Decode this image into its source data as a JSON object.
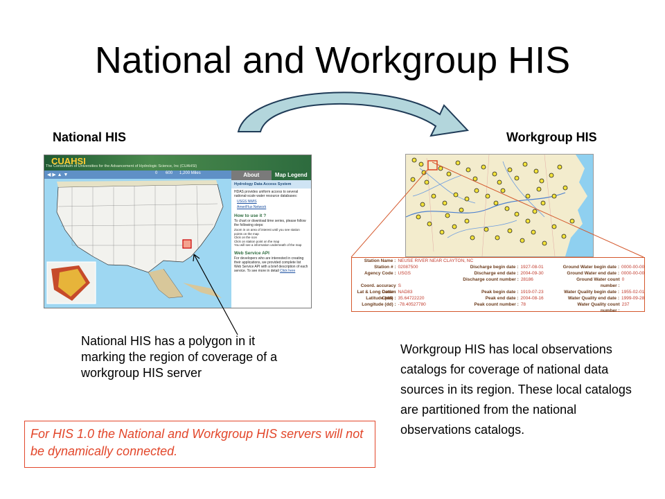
{
  "slide": {
    "title": "National and Workgroup HIS",
    "left_label": "National HIS",
    "right_label": "Workgroup HIS",
    "left_caption": "National HIS has a polygon in it marking the region of coverage of a workgroup HIS server",
    "right_caption": "Workgroup HIS has local observations catalogs for coverage of national data sources in its region.  These local catalogs are partitioned from the national observations catalogs.",
    "note": "For HIS 1.0 the National and Workgroup HIS servers will not be dynamically connected."
  },
  "national_screenshot": {
    "banner_text": "The Consortium of Universities for the Advancement of Hydrologic Science, Inc (CUAHSI)",
    "logo_text": "CUAHSI",
    "tab_about": "About",
    "tab_legend": "Map Legend",
    "scale_labels": [
      "0",
      "600",
      "1,200 Miles"
    ],
    "panel_heading": "Hydrology Data Access System",
    "panel_intro": "HDAS provides uniform access to several national-scale water resource databases:",
    "links": [
      "USGS NWIS",
      "AmeriFlux Network"
    ],
    "howto_heading": "How to use it ?",
    "howto_intro": "To chart or download time series, please follow the following steps:",
    "steps": [
      "Zoom in on area of interest until you see station points on the map",
      "Click on the icon",
      "Click on station point on the map",
      "You will see a information underneath of the map"
    ],
    "api_heading": "Web Service API",
    "api_text": "For developers who are interested in creating their applications, we provided complete list Web Service API with a brief description of each service. To see more in detail",
    "api_link": "Click here"
  },
  "workgroup_table": {
    "rows": [
      {
        "l1": "Station Name :",
        "v1": "NEUSE RIVER NEAR CLAYTON, NC",
        "l2": "",
        "v2": "",
        "l3": "",
        "v3": ""
      },
      {
        "l1": "Station # :",
        "v1": "02087500",
        "l2": "Discharge begin date :",
        "v2": "1927-08-01",
        "l3": "Ground Water begin date :",
        "v3": "0000-00-00"
      },
      {
        "l1": "Agency Code :",
        "v1": "USGS",
        "l2": "Discharge end date :",
        "v2": "2004-09-30",
        "l3": "Ground Water end date :",
        "v3": "0000-00-00"
      },
      {
        "l1": "",
        "v1": "",
        "l2": "Discharge count number :",
        "v2": "28186",
        "l3": "Ground Water count number :",
        "v3": "0"
      },
      {
        "l1": "Coord. accuracy Code :",
        "v1": "S",
        "l2": "",
        "v2": "",
        "l3": "",
        "v3": ""
      },
      {
        "l1": "Lat & Long Datum Code :",
        "v1": "NAD83",
        "l2": "Peak begin date :",
        "v2": "1919-07-23",
        "l3": "Water Quality begin date :",
        "v3": "1955-02-01"
      },
      {
        "l1": "Latitude (dd) :",
        "v1": "35.64722220",
        "l2": "Peak end date :",
        "v2": "2004-08-16",
        "l3": "Water Quality end date :",
        "v3": "1999-09-28"
      },
      {
        "l1": "Longitude (dd) :",
        "v1": "-78.40527780",
        "l2": "Peak count number :",
        "v2": "78",
        "l3": "Water Quality count number :",
        "v3": "237"
      }
    ]
  },
  "colors": {
    "note_red": "#e2462a",
    "arrow_fill": "#b3d6dc",
    "arrow_stroke": "#1f3b57",
    "leader_red": "#d4572b",
    "map_water": "#9ed7f2",
    "banner_green": "#2f6b3b"
  }
}
